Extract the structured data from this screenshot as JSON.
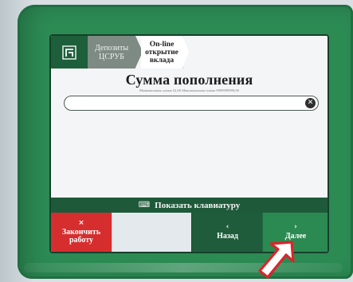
{
  "breadcrumb": {
    "section_label": "Депозиты\nЦСРУБ",
    "step_label": "On-line\nоткрытие\nвклада"
  },
  "page": {
    "title": "Сумма пополнения",
    "subtitle": "Минимальная сумма 52,00 Максимальная сумма 9999999999,00"
  },
  "amount_input": {
    "value": "",
    "clear_icon": "close-circle-icon"
  },
  "keyboard_bar": {
    "label": "Показать клавиатуру",
    "icon": "keyboard-icon"
  },
  "buttons": {
    "finish": {
      "glyph": "×",
      "label": "Закончить\nработу",
      "color": "#d62e2e"
    },
    "back": {
      "glyph": "‹",
      "label": "Назад",
      "color": "#1f5c3b"
    },
    "next": {
      "glyph": "›",
      "label": "Далее",
      "color": "#2b8a52"
    }
  },
  "colors": {
    "frame": "#2c8a53",
    "brand_dark": "#1d5f3a",
    "screen_bg": "#f3f5f6"
  }
}
